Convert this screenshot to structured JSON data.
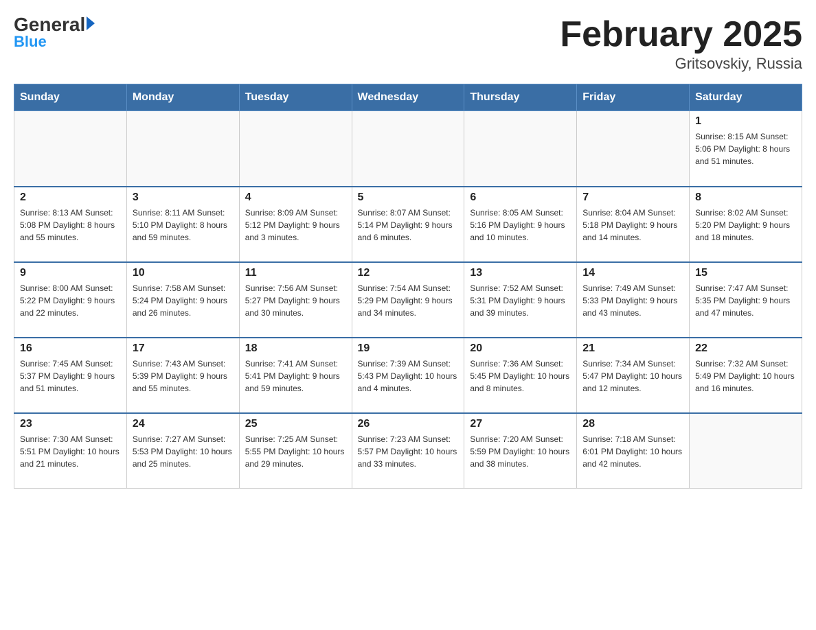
{
  "header": {
    "logo_general": "General",
    "logo_blue": "Blue",
    "main_title": "February 2025",
    "subtitle": "Gritsovskiy, Russia"
  },
  "weekdays": [
    "Sunday",
    "Monday",
    "Tuesday",
    "Wednesday",
    "Thursday",
    "Friday",
    "Saturday"
  ],
  "weeks": [
    [
      {
        "day": "",
        "info": ""
      },
      {
        "day": "",
        "info": ""
      },
      {
        "day": "",
        "info": ""
      },
      {
        "day": "",
        "info": ""
      },
      {
        "day": "",
        "info": ""
      },
      {
        "day": "",
        "info": ""
      },
      {
        "day": "1",
        "info": "Sunrise: 8:15 AM\nSunset: 5:06 PM\nDaylight: 8 hours\nand 51 minutes."
      }
    ],
    [
      {
        "day": "2",
        "info": "Sunrise: 8:13 AM\nSunset: 5:08 PM\nDaylight: 8 hours\nand 55 minutes."
      },
      {
        "day": "3",
        "info": "Sunrise: 8:11 AM\nSunset: 5:10 PM\nDaylight: 8 hours\nand 59 minutes."
      },
      {
        "day": "4",
        "info": "Sunrise: 8:09 AM\nSunset: 5:12 PM\nDaylight: 9 hours\nand 3 minutes."
      },
      {
        "day": "5",
        "info": "Sunrise: 8:07 AM\nSunset: 5:14 PM\nDaylight: 9 hours\nand 6 minutes."
      },
      {
        "day": "6",
        "info": "Sunrise: 8:05 AM\nSunset: 5:16 PM\nDaylight: 9 hours\nand 10 minutes."
      },
      {
        "day": "7",
        "info": "Sunrise: 8:04 AM\nSunset: 5:18 PM\nDaylight: 9 hours\nand 14 minutes."
      },
      {
        "day": "8",
        "info": "Sunrise: 8:02 AM\nSunset: 5:20 PM\nDaylight: 9 hours\nand 18 minutes."
      }
    ],
    [
      {
        "day": "9",
        "info": "Sunrise: 8:00 AM\nSunset: 5:22 PM\nDaylight: 9 hours\nand 22 minutes."
      },
      {
        "day": "10",
        "info": "Sunrise: 7:58 AM\nSunset: 5:24 PM\nDaylight: 9 hours\nand 26 minutes."
      },
      {
        "day": "11",
        "info": "Sunrise: 7:56 AM\nSunset: 5:27 PM\nDaylight: 9 hours\nand 30 minutes."
      },
      {
        "day": "12",
        "info": "Sunrise: 7:54 AM\nSunset: 5:29 PM\nDaylight: 9 hours\nand 34 minutes."
      },
      {
        "day": "13",
        "info": "Sunrise: 7:52 AM\nSunset: 5:31 PM\nDaylight: 9 hours\nand 39 minutes."
      },
      {
        "day": "14",
        "info": "Sunrise: 7:49 AM\nSunset: 5:33 PM\nDaylight: 9 hours\nand 43 minutes."
      },
      {
        "day": "15",
        "info": "Sunrise: 7:47 AM\nSunset: 5:35 PM\nDaylight: 9 hours\nand 47 minutes."
      }
    ],
    [
      {
        "day": "16",
        "info": "Sunrise: 7:45 AM\nSunset: 5:37 PM\nDaylight: 9 hours\nand 51 minutes."
      },
      {
        "day": "17",
        "info": "Sunrise: 7:43 AM\nSunset: 5:39 PM\nDaylight: 9 hours\nand 55 minutes."
      },
      {
        "day": "18",
        "info": "Sunrise: 7:41 AM\nSunset: 5:41 PM\nDaylight: 9 hours\nand 59 minutes."
      },
      {
        "day": "19",
        "info": "Sunrise: 7:39 AM\nSunset: 5:43 PM\nDaylight: 10 hours\nand 4 minutes."
      },
      {
        "day": "20",
        "info": "Sunrise: 7:36 AM\nSunset: 5:45 PM\nDaylight: 10 hours\nand 8 minutes."
      },
      {
        "day": "21",
        "info": "Sunrise: 7:34 AM\nSunset: 5:47 PM\nDaylight: 10 hours\nand 12 minutes."
      },
      {
        "day": "22",
        "info": "Sunrise: 7:32 AM\nSunset: 5:49 PM\nDaylight: 10 hours\nand 16 minutes."
      }
    ],
    [
      {
        "day": "23",
        "info": "Sunrise: 7:30 AM\nSunset: 5:51 PM\nDaylight: 10 hours\nand 21 minutes."
      },
      {
        "day": "24",
        "info": "Sunrise: 7:27 AM\nSunset: 5:53 PM\nDaylight: 10 hours\nand 25 minutes."
      },
      {
        "day": "25",
        "info": "Sunrise: 7:25 AM\nSunset: 5:55 PM\nDaylight: 10 hours\nand 29 minutes."
      },
      {
        "day": "26",
        "info": "Sunrise: 7:23 AM\nSunset: 5:57 PM\nDaylight: 10 hours\nand 33 minutes."
      },
      {
        "day": "27",
        "info": "Sunrise: 7:20 AM\nSunset: 5:59 PM\nDaylight: 10 hours\nand 38 minutes."
      },
      {
        "day": "28",
        "info": "Sunrise: 7:18 AM\nSunset: 6:01 PM\nDaylight: 10 hours\nand 42 minutes."
      },
      {
        "day": "",
        "info": ""
      }
    ]
  ]
}
